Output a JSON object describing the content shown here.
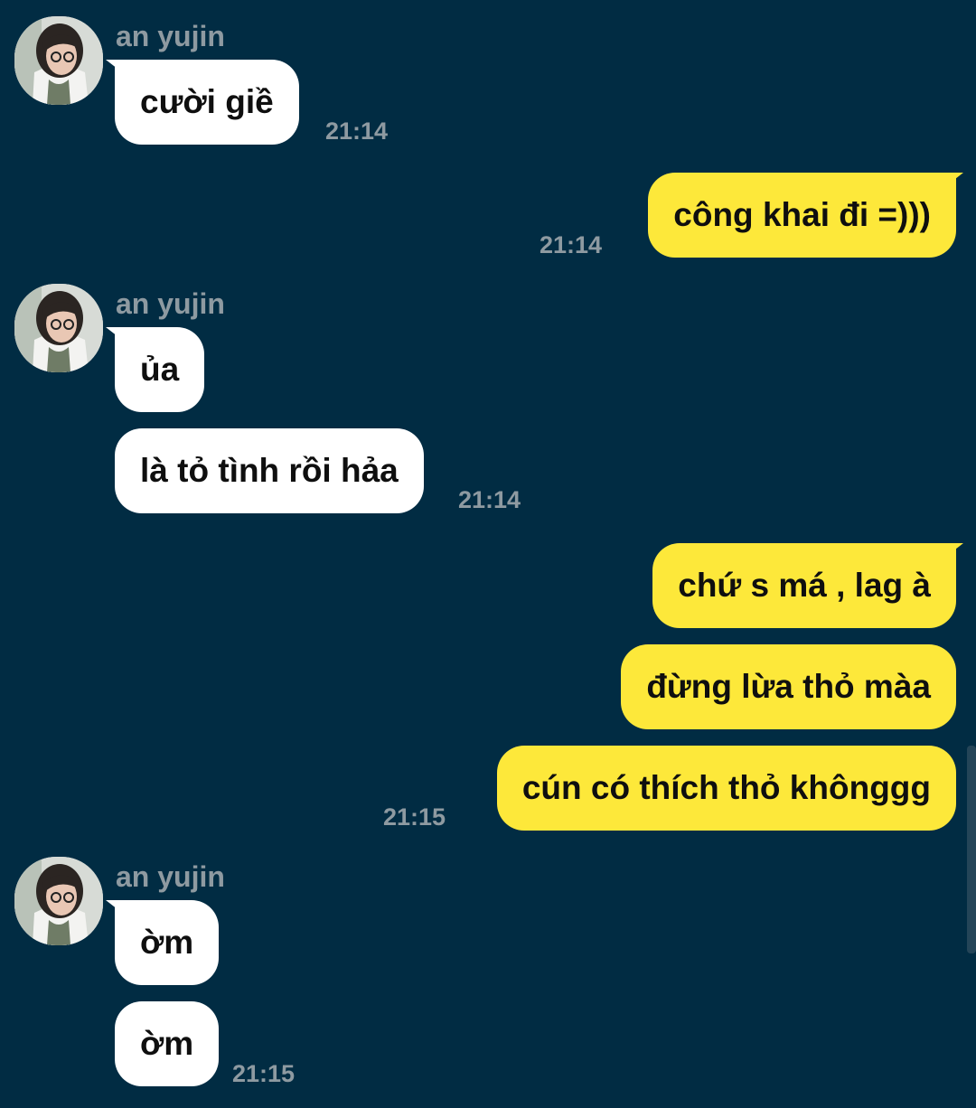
{
  "contact": {
    "name": "an yujin",
    "avatar_icon": "profile-photo-avatar-icon"
  },
  "colors": {
    "background": "#012c43",
    "incoming_bubble": "#ffffff",
    "outgoing_bubble": "#fde83a",
    "meta_text": "#8e9aa1"
  },
  "messages": [
    {
      "direction": "in",
      "text": "cười giề",
      "time": "21:14"
    },
    {
      "direction": "out",
      "text": "công khai đi =)))",
      "time": "21:14"
    },
    {
      "direction": "in",
      "text": "ủa",
      "time": ""
    },
    {
      "direction": "in",
      "text": "là tỏ tình rồi hảa",
      "time": "21:14"
    },
    {
      "direction": "out",
      "text": "chứ s má , lag à",
      "time": ""
    },
    {
      "direction": "out",
      "text": "đừng lừa thỏ màa",
      "time": ""
    },
    {
      "direction": "out",
      "text": "cún có thích thỏ khônggg",
      "time": "21:15"
    },
    {
      "direction": "in",
      "text": "ờm",
      "time": ""
    },
    {
      "direction": "in",
      "text": "ờm",
      "time": "21:15"
    }
  ]
}
